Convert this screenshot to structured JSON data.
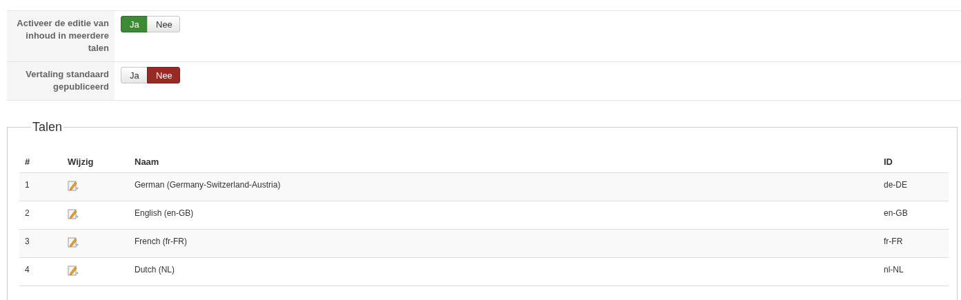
{
  "settings": [
    {
      "label": "Activeer de editie van inhoud in meerdere talen",
      "options": [
        {
          "label": "Ja",
          "kind": "yes",
          "selected": true
        },
        {
          "label": "Nee",
          "kind": "no",
          "selected": false
        }
      ]
    },
    {
      "label": "Vertaling standaard gepubliceerd",
      "options": [
        {
          "label": "Ja",
          "kind": "yes",
          "selected": false
        },
        {
          "label": "Nee",
          "kind": "no",
          "selected": true
        }
      ]
    }
  ],
  "languages": {
    "title": "Talen",
    "columns": [
      "#",
      "Wijzig",
      "Naam",
      "ID"
    ],
    "rows": [
      {
        "number": "1",
        "name": "German (Germany-Switzerland-Austria)",
        "id": "de-DE"
      },
      {
        "number": "2",
        "name": "English (en-GB)",
        "id": "en-GB"
      },
      {
        "number": "3",
        "name": "French (fr-FR)",
        "id": "fr-FR"
      },
      {
        "number": "4",
        "name": "Dutch (NL)",
        "id": "nl-NL"
      }
    ]
  }
}
